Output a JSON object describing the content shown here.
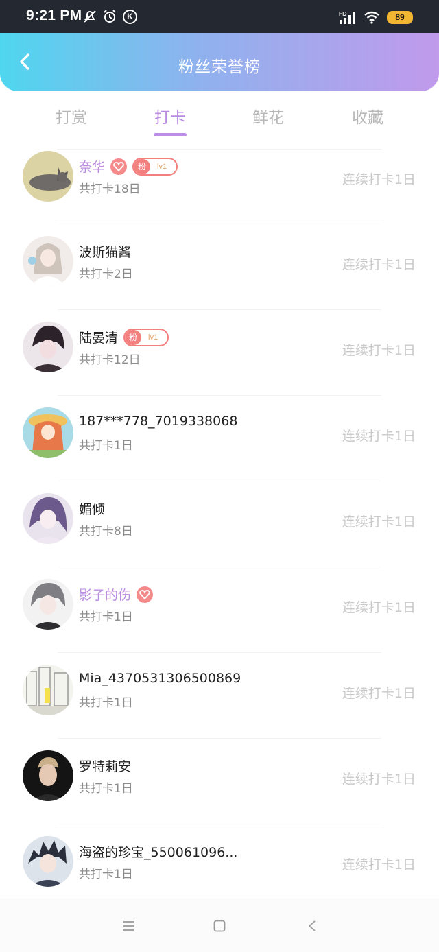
{
  "status_bar": {
    "time": "9:21 PM",
    "k_icon_letter": "K",
    "battery": "89",
    "network_label": "HD"
  },
  "header": {
    "title": "粉丝荣誉榜",
    "gradient": [
      "#4fd6ef",
      "#c09aeb"
    ]
  },
  "tabs": [
    {
      "label": "打赏",
      "active": false
    },
    {
      "label": "打卡",
      "active": true
    },
    {
      "label": "鲜花",
      "active": false
    },
    {
      "label": "收藏",
      "active": false
    }
  ],
  "accent_color": "#b98be0",
  "fans": [
    {
      "name": "奈华",
      "vip": true,
      "heart_badge": true,
      "fan_badge": {
        "label": "粉",
        "level": "lv1"
      },
      "total": "共打卡18日",
      "streak": "连续打卡1日",
      "avatar": "grey-cat-avatar"
    },
    {
      "name": "波斯猫酱",
      "vip": false,
      "heart_badge": false,
      "fan_badge": null,
      "total": "共打卡2日",
      "streak": "连续打卡1日",
      "avatar": "anime-girl-white-avatar"
    },
    {
      "name": "陆晏清",
      "vip": false,
      "heart_badge": false,
      "fan_badge": {
        "label": "粉",
        "level": "lv1"
      },
      "total": "共打卡12日",
      "streak": "连续打卡1日",
      "avatar": "dark-hair-boy-avatar"
    },
    {
      "name": "187***778_7019338068",
      "vip": false,
      "heart_badge": false,
      "fan_badge": null,
      "total": "共打卡1日",
      "streak": "连续打卡1日",
      "avatar": "orange-hair-girl-avatar"
    },
    {
      "name": "媚倾",
      "vip": false,
      "heart_badge": false,
      "fan_badge": null,
      "total": "共打卡8日",
      "streak": "连续打卡1日",
      "avatar": "purple-hair-girl-avatar"
    },
    {
      "name": "影子的伤",
      "vip": true,
      "heart_badge": true,
      "fan_badge": null,
      "total": "共打卡1日",
      "streak": "连续打卡1日",
      "avatar": "grey-hair-boy-avatar"
    },
    {
      "name": "Mia_4370531306500869",
      "vip": false,
      "heart_badge": false,
      "fan_badge": null,
      "total": "共打卡1日",
      "streak": "连续打卡1日",
      "avatar": "street-sketch-avatar"
    },
    {
      "name": "罗特莉安",
      "vip": false,
      "heart_badge": false,
      "fan_badge": null,
      "total": "共打卡1日",
      "streak": "连续打卡1日",
      "avatar": "portrait-man-avatar"
    },
    {
      "name": "海盗的珍宝_550061096...",
      "vip": false,
      "heart_badge": false,
      "fan_badge": null,
      "total": "共打卡1日",
      "streak": "连续打卡1日",
      "avatar": "spiky-hair-boy-avatar"
    }
  ],
  "nav": [
    "menu-icon",
    "home-square-icon",
    "back-triangle-icon"
  ]
}
